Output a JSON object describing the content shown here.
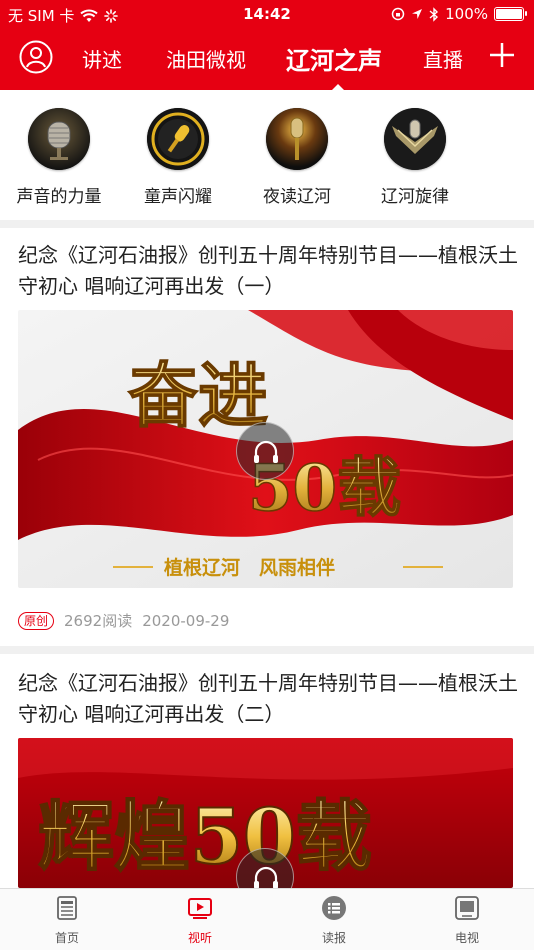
{
  "status_bar": {
    "carrier": "无 SIM 卡",
    "time": "14:42",
    "battery": "100%",
    "battery_level": 1.0
  },
  "nav": {
    "tabs": [
      {
        "label": "讲述"
      },
      {
        "label": "油田微视"
      },
      {
        "label": "辽河之声",
        "active": true
      },
      {
        "label": "直播"
      }
    ],
    "avatar_icon": "user-circle-icon",
    "add_icon": "plus-icon"
  },
  "categories": [
    {
      "label": "声音的力量",
      "icon": "vintage-microphone-icon"
    },
    {
      "label": "童声闪耀",
      "icon": "golden-microphone-icon"
    },
    {
      "label": "夜读辽河",
      "icon": "glowing-microphone-icon"
    },
    {
      "label": "辽河旋律",
      "icon": "winged-microphone-icon"
    }
  ],
  "articles": [
    {
      "title": "纪念《辽河石油报》创刊五十周年特别节目——植根沃土守初心 唱响辽河再出发（一）",
      "image_text_main": "奋进",
      "image_text_num": "50载",
      "image_subtitle": "植根辽河　风雨相伴",
      "badge": "原创",
      "reads": "2692阅读",
      "date": "2020-09-29"
    },
    {
      "title": "纪念《辽河石油报》创刊五十周年特别节目——植根沃土守初心 唱响辽河再出发（二）",
      "image_text_main": "辉煌50载"
    }
  ],
  "tabbar": {
    "items": [
      {
        "label": "首页",
        "icon": "newspaper-icon"
      },
      {
        "label": "视听",
        "icon": "video-play-icon",
        "active": true
      },
      {
        "label": "读报",
        "icon": "list-icon"
      },
      {
        "label": "电视",
        "icon": "tv-icon"
      }
    ]
  },
  "colors": {
    "brand_red": "#e60012",
    "text": "#222222",
    "meta": "#999999",
    "background_gray": "#f0f0f0"
  }
}
